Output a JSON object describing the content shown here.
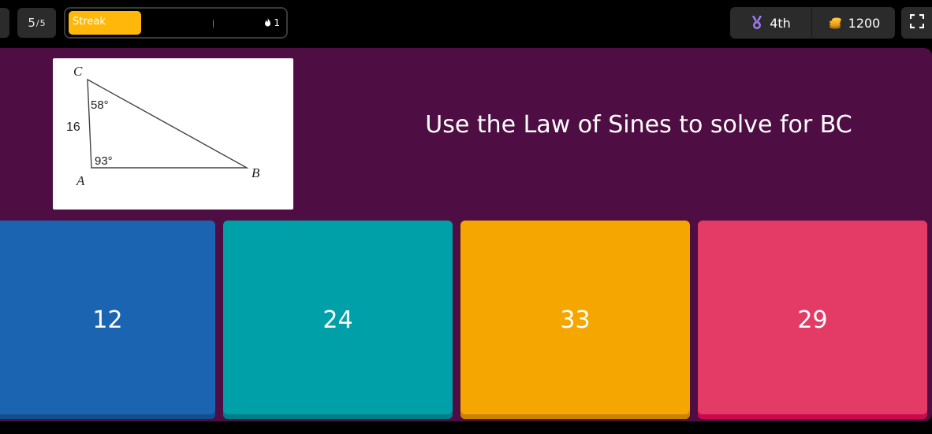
{
  "progress": {
    "current": "5",
    "total": "5"
  },
  "streak": {
    "label": "Streak",
    "count": "1",
    "fill_fraction": 0.33
  },
  "stats": {
    "rank": "4th",
    "coins": "1200"
  },
  "question": {
    "text": "Use the Law of Sines to solve for BC",
    "diagram": {
      "vertex_c": "C",
      "vertex_a": "A",
      "vertex_b": "B",
      "angle_c": "58°",
      "angle_a": "93°",
      "side_ca": "16"
    }
  },
  "options": [
    {
      "label": "12",
      "color": "#1a64b1"
    },
    {
      "label": "24",
      "color": "#00a0a8"
    },
    {
      "label": "33",
      "color": "#f6a600"
    },
    {
      "label": "29",
      "color": "#e43a66"
    }
  ],
  "icons": {
    "rank": "medal-icon",
    "coins": "coin-stack-icon",
    "streak": "flame-icon",
    "fullscreen": "fullscreen-icon"
  }
}
